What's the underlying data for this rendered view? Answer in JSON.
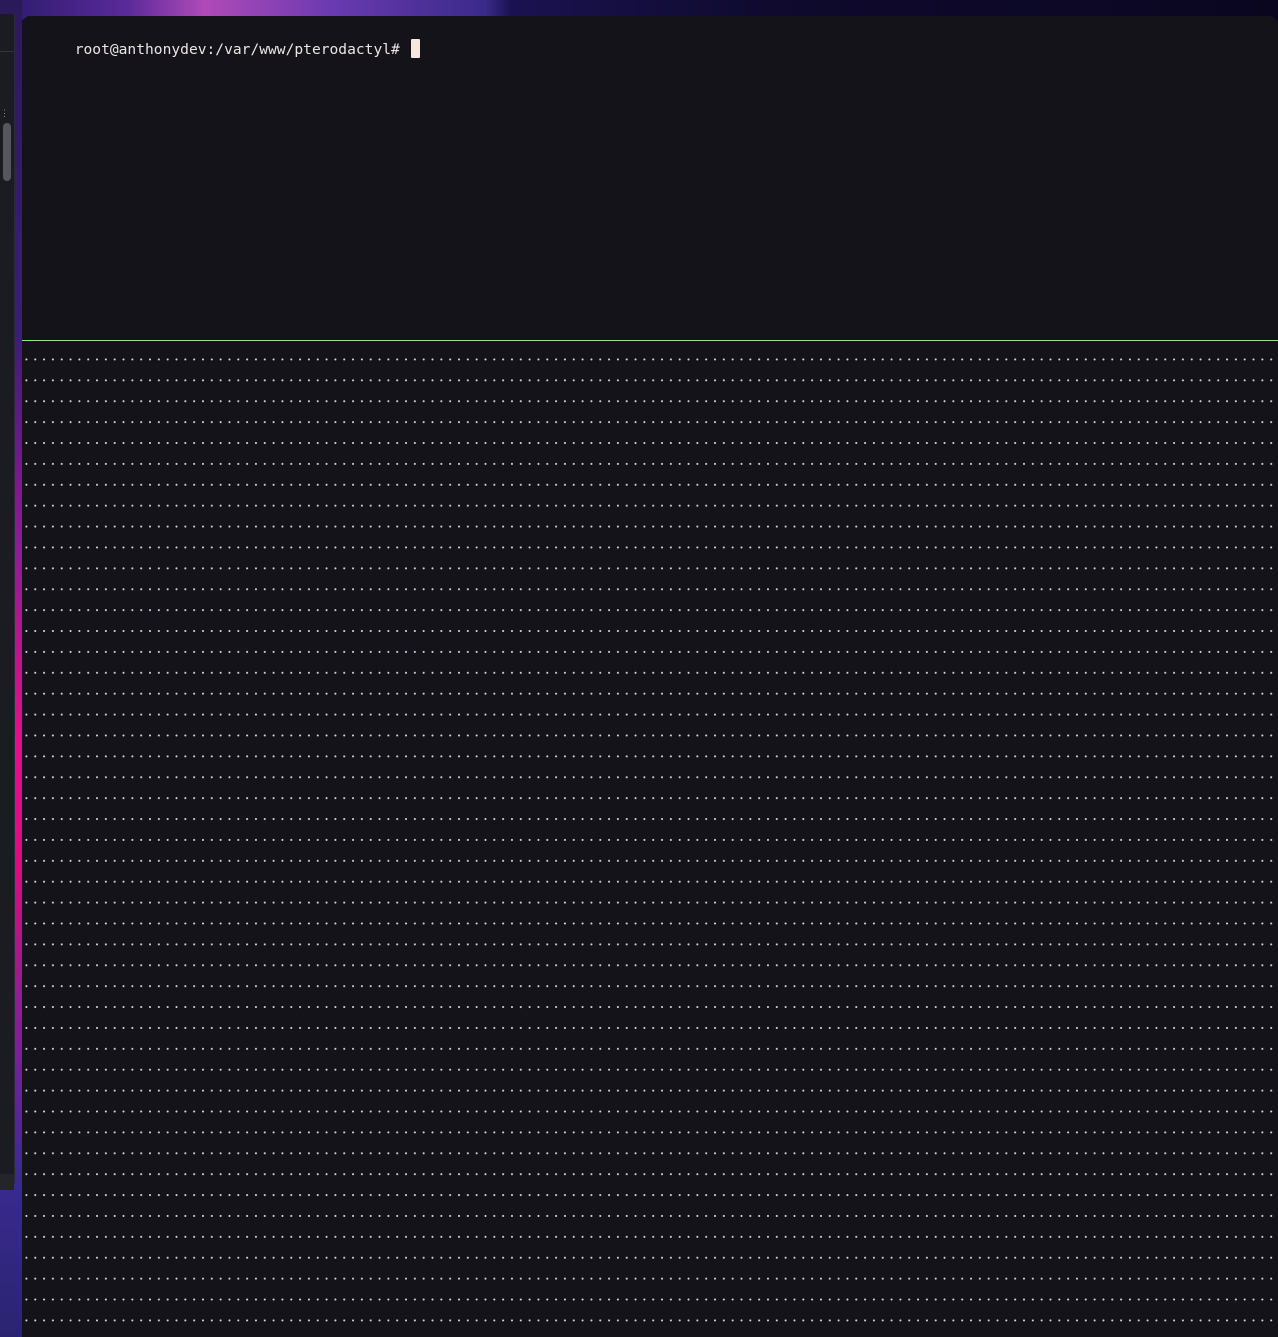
{
  "terminal": {
    "prompt": "root@anthonydev:/var/www/pterodactyl# ",
    "cursor": "block",
    "lower_pane": "dotted empty pane (tmux split)"
  },
  "colors": {
    "terminal_bg": "#141319",
    "text": "#e9e6e2",
    "cursor": "#f6e7df",
    "pane_divider": "#9fdc96",
    "wallpaper_accent": "#e0108a"
  }
}
